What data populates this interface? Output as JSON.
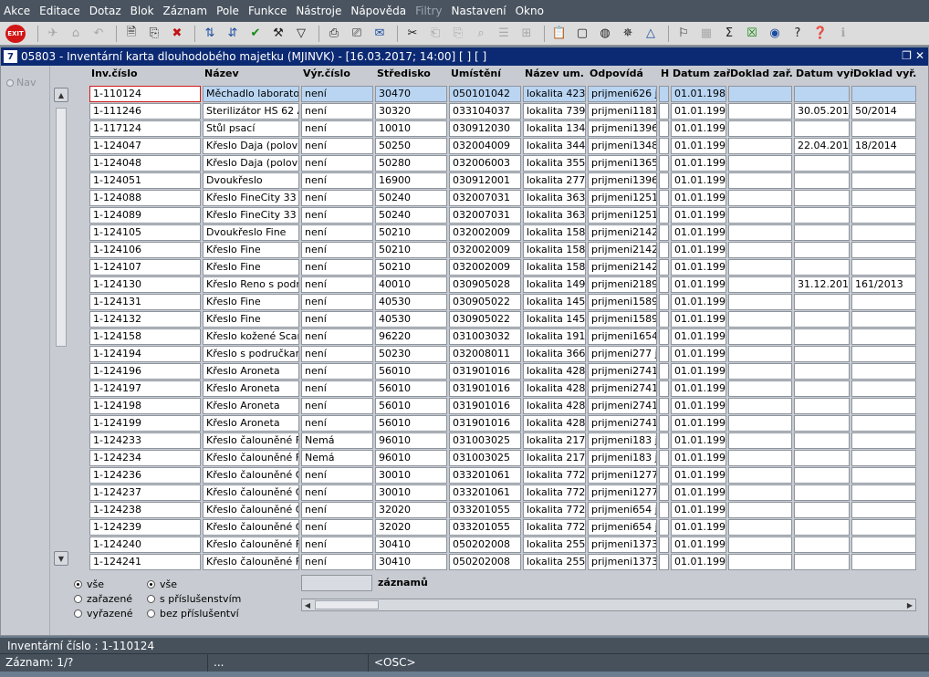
{
  "menu": [
    "Akce",
    "Editace",
    "Dotaz",
    "Blok",
    "Záznam",
    "Pole",
    "Funkce",
    "Nástroje",
    "Nápověda",
    "Filtry",
    "Nastavení",
    "Okno"
  ],
  "menu_disabled": "Filtry",
  "toolbar": {
    "exit_label": "EXIT"
  },
  "window": {
    "title": "05803 - Inventární karta dlouhodobého majetku (MJINVK) - [16.03.2017; 14:00]  [ ]  [ ]",
    "app_icon": "7"
  },
  "nav_label": "Nav",
  "columns": [
    "Inv.číslo",
    "Název",
    "Výr.číslo",
    "Středisko",
    "Umístění",
    "Název um.",
    "Odpovídá",
    "H",
    "Datum zař.",
    "Doklad zař.",
    "Datum vyř.",
    "Doklad vyř."
  ],
  "rows": [
    [
      "1-110124",
      "Měchadlo laboratorn",
      "není",
      "30470",
      "050101042",
      "lokalita 4234",
      "prijmeni626 jme",
      "",
      "01.01.1986",
      "",
      "",
      ""
    ],
    [
      "1-111246",
      "Sterilizátor HS 62 A",
      "není",
      "30320",
      "033104037",
      "lokalita 7394",
      "prijmeni1181 jm",
      "",
      "01.01.1991",
      "",
      "30.05.2014",
      "50/2014"
    ],
    [
      "1-117124",
      "Stůl psací",
      "není",
      "10010",
      "030912030",
      "lokalita 1344",
      "prijmeni1396 jm",
      "",
      "01.01.1992",
      "",
      "",
      ""
    ],
    [
      "1-124047",
      "Křeslo Daja (polovin",
      "není",
      "50250",
      "032004009",
      "lokalita 3448",
      "prijmeni1348 jm",
      "",
      "01.01.1992",
      "",
      "22.04.2014",
      "18/2014"
    ],
    [
      "1-124048",
      "Křeslo Daja (polovin",
      "není",
      "50280",
      "032006003",
      "lokalita 3551",
      "prijmeni1365 jm",
      "",
      "01.01.1992",
      "",
      "",
      ""
    ],
    [
      "1-124051",
      "Dvoukřeslo",
      "není",
      "16900",
      "030912001",
      "lokalita 2777",
      "prijmeni1396 jm",
      "",
      "01.01.1992",
      "",
      "",
      ""
    ],
    [
      "1-124088",
      "Křeslo FineCity 33 č",
      "není",
      "50240",
      "032007031",
      "lokalita 3633",
      "prijmeni1251 jm",
      "",
      "01.01.1995",
      "",
      "",
      ""
    ],
    [
      "1-124089",
      "Křeslo FineCity 33 č",
      "není",
      "50240",
      "032007031",
      "lokalita 3633",
      "prijmeni1251 jm",
      "",
      "01.01.1995",
      "",
      "",
      ""
    ],
    [
      "1-124105",
      "Dvoukřeslo Fine",
      "není",
      "50210",
      "032002009",
      "lokalita 1582",
      "prijmeni2142 jm",
      "",
      "01.01.1995",
      "",
      "",
      ""
    ],
    [
      "1-124106",
      "Křeslo Fine",
      "není",
      "50210",
      "032002009",
      "lokalita 1582",
      "prijmeni2142 jm",
      "",
      "01.01.1995",
      "",
      "",
      ""
    ],
    [
      "1-124107",
      "Křeslo Fine",
      "není",
      "50210",
      "032002009",
      "lokalita 1582",
      "prijmeni2142 jm",
      "",
      "01.01.1995",
      "",
      "",
      ""
    ],
    [
      "1-124130",
      "Křeslo Reno s podr",
      "není",
      "40010",
      "030905028",
      "lokalita 1491",
      "prijmeni2189 jm",
      "",
      "01.01.1995",
      "",
      "31.12.2013",
      "161/2013"
    ],
    [
      "1-124131",
      "Křeslo Fine",
      "není",
      "40530",
      "030905022",
      "lokalita 1453",
      "prijmeni1589 jm",
      "",
      "01.01.1995",
      "",
      "",
      ""
    ],
    [
      "1-124132",
      "Křeslo Fine",
      "není",
      "40530",
      "030905022",
      "lokalita 1453",
      "prijmeni1589 jm",
      "",
      "01.01.1995",
      "",
      "",
      ""
    ],
    [
      "1-124158",
      "Křeslo kožené Scar",
      "není",
      "96220",
      "031003032",
      "lokalita 1912",
      "prijmeni1654 jm",
      "",
      "01.01.1996",
      "",
      "",
      ""
    ],
    [
      "1-124194",
      "Křeslo s područkam",
      "není",
      "50230",
      "032008011",
      "lokalita 3668",
      "prijmeni277 jme",
      "",
      "01.01.1997",
      "",
      "",
      ""
    ],
    [
      "1-124196",
      "Křeslo Aroneta",
      "není",
      "56010",
      "031901016",
      "lokalita 4288",
      "prijmeni2741 jm",
      "",
      "01.01.1998",
      "",
      "",
      ""
    ],
    [
      "1-124197",
      "Křeslo Aroneta",
      "není",
      "56010",
      "031901016",
      "lokalita 4288",
      "prijmeni2741 jm",
      "",
      "01.01.1998",
      "",
      "",
      ""
    ],
    [
      "1-124198",
      "Křeslo Aroneta",
      "není",
      "56010",
      "031901016",
      "lokalita 4288",
      "prijmeni2741 jm",
      "",
      "01.01.1998",
      "",
      "",
      ""
    ],
    [
      "1-124199",
      "Křeslo Aroneta",
      "není",
      "56010",
      "031901016",
      "lokalita 4288",
      "prijmeni2741 jm",
      "",
      "01.01.1998",
      "",
      "",
      ""
    ],
    [
      "1-124233",
      "Křeslo čalouněné F",
      "Nemá",
      "96010",
      "031003025",
      "lokalita 2175",
      "prijmeni183 jme",
      "",
      "01.01.1998",
      "",
      "",
      ""
    ],
    [
      "1-124234",
      "Křeslo čalouněné F",
      "Nemá",
      "96010",
      "031003025",
      "lokalita 2175",
      "prijmeni183 jme",
      "",
      "01.01.1998",
      "",
      "",
      ""
    ],
    [
      "1-124236",
      "Křeslo čalouněné O",
      "není",
      "30010",
      "033201061",
      "lokalita 7729",
      "prijmeni1277 jm",
      "",
      "01.01.1998",
      "",
      "",
      ""
    ],
    [
      "1-124237",
      "Křeslo čalouněné O",
      "není",
      "30010",
      "033201061",
      "lokalita 7729",
      "prijmeni1277 jm",
      "",
      "01.01.1998",
      "",
      "",
      ""
    ],
    [
      "1-124238",
      "Křeslo čalouněné O",
      "není",
      "32020",
      "033201055",
      "lokalita 7723",
      "prijmeni654 jme",
      "",
      "01.01.1998",
      "",
      "",
      ""
    ],
    [
      "1-124239",
      "Křeslo čalouněné O",
      "není",
      "32020",
      "033201055",
      "lokalita 7723",
      "prijmeni654 jme",
      "",
      "01.01.1998",
      "",
      "",
      ""
    ],
    [
      "1-124240",
      "Křeslo čalouněné F",
      "není",
      "30410",
      "050202008",
      "lokalita 2558",
      "prijmeni1373 jm",
      "",
      "01.01.1998",
      "",
      "",
      ""
    ],
    [
      "1-124241",
      "Křeslo čalouněné F",
      "není",
      "30410",
      "050202008",
      "lokalita 2558",
      "prijmeni1373 jm",
      "",
      "01.01.1998",
      "",
      "",
      ""
    ]
  ],
  "filters": {
    "group1": [
      {
        "label": "vše",
        "checked": true
      },
      {
        "label": "zařazené",
        "checked": false
      },
      {
        "label": "vyřazené",
        "checked": false
      }
    ],
    "group2": [
      {
        "label": "vše",
        "checked": true
      },
      {
        "label": "s příslušenstvím",
        "checked": false
      },
      {
        "label": "bez příslušentví",
        "checked": false
      }
    ]
  },
  "record_count_value": "",
  "record_count_label": "záznamů",
  "status": {
    "line1": "Inventární číslo : 1-110124",
    "line2_record": "Záznam: 1/?",
    "line2_dots": "...",
    "line2_osc": "<OSC>"
  },
  "colors": {
    "titlebar": "#0c2a73",
    "selection": "#b9d5f2",
    "current_cell_border": "#d21a1a"
  }
}
